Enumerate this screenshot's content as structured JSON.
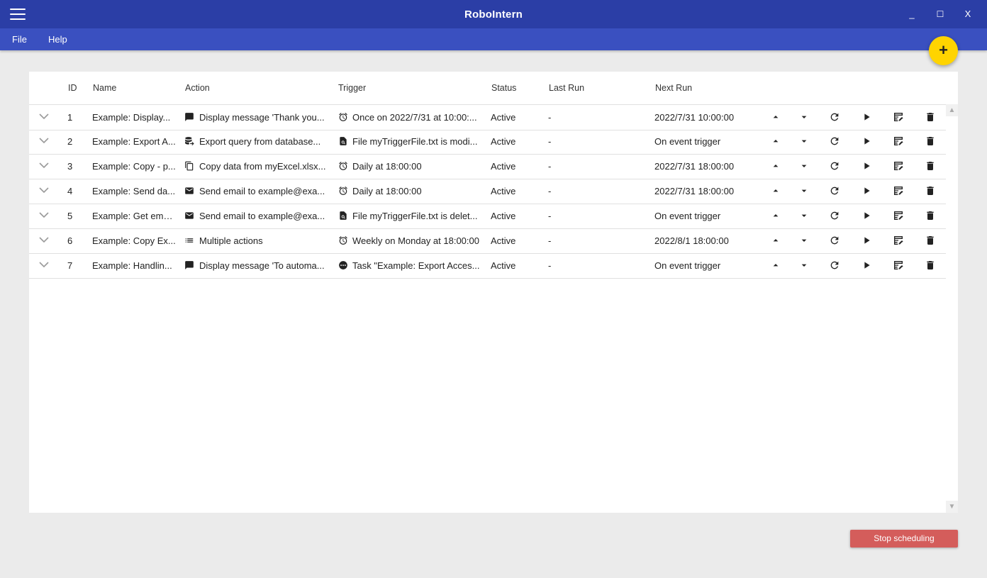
{
  "window": {
    "title": "RoboIntern",
    "minimize": "_",
    "maximize": "☐",
    "close": "X"
  },
  "menu": {
    "file": "File",
    "help": "Help"
  },
  "fab": {
    "label": "+"
  },
  "table": {
    "headers": {
      "id": "ID",
      "name": "Name",
      "action": "Action",
      "trigger": "Trigger",
      "status": "Status",
      "last_run": "Last Run",
      "next_run": "Next Run"
    },
    "rows": [
      {
        "id": "1",
        "name": "Example: Display...",
        "action_icon": "message-icon",
        "action": "Display message 'Thank you...",
        "trigger_icon": "alarm-clock-icon",
        "trigger": "Once on 2022/7/31 at 10:00:...",
        "status": "Active",
        "last_run": "-",
        "next_run": "2022/7/31 10:00:00"
      },
      {
        "id": "2",
        "name": "Example: Export A...",
        "action_icon": "database-export-icon",
        "action": "Export query from database...",
        "trigger_icon": "file-search-icon",
        "trigger": "File myTriggerFile.txt is modi...",
        "status": "Active",
        "last_run": "-",
        "next_run": "On event trigger"
      },
      {
        "id": "3",
        "name": "Example: Copy - p...",
        "action_icon": "copy-icon",
        "action": "Copy data from myExcel.xlsx...",
        "trigger_icon": "alarm-clock-icon",
        "trigger": "Daily at 18:00:00",
        "status": "Active",
        "last_run": "-",
        "next_run": "2022/7/31 18:00:00"
      },
      {
        "id": "4",
        "name": "Example: Send da...",
        "action_icon": "email-icon",
        "action": "Send email to example@exa...",
        "trigger_icon": "alarm-clock-icon",
        "trigger": "Daily at 18:00:00",
        "status": "Active",
        "last_run": "-",
        "next_run": "2022/7/31 18:00:00"
      },
      {
        "id": "5",
        "name": "Example: Get ema...",
        "action_icon": "email-icon",
        "action": "Send email to example@exa...",
        "trigger_icon": "file-search-icon",
        "trigger": "File myTriggerFile.txt is delet...",
        "status": "Active",
        "last_run": "-",
        "next_run": "On event trigger"
      },
      {
        "id": "6",
        "name": "Example: Copy Ex...",
        "action_icon": "list-icon",
        "action": "Multiple actions",
        "trigger_icon": "alarm-clock-icon",
        "trigger": "Weekly on Monday at 18:00:00",
        "status": "Active",
        "last_run": "-",
        "next_run": "2022/8/1 18:00:00"
      },
      {
        "id": "7",
        "name": "Example: Handlin...",
        "action_icon": "message-icon",
        "action": "Display message 'To automa...",
        "trigger_icon": "task-dots-icon",
        "trigger": "Task \"Example: Export Acces...",
        "status": "Active",
        "last_run": "-",
        "next_run": "On event trigger"
      }
    ]
  },
  "footer": {
    "stop_label": "Stop scheduling"
  },
  "colors": {
    "titlebar": "#2b3ea6",
    "menubar": "#3a50c0",
    "fab": "#ffd400",
    "stop_button": "#d45d5b"
  }
}
